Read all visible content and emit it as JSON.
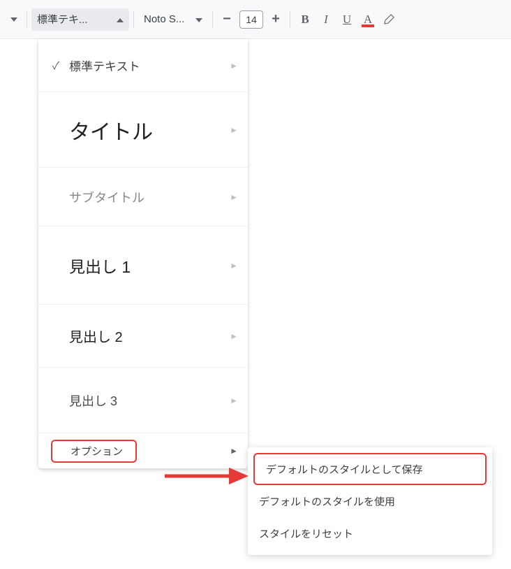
{
  "toolbar": {
    "style_dropdown_label": "標準テキ...",
    "font_dropdown_label": "Noto S...",
    "font_size": "14",
    "bold": "B",
    "italic": "I",
    "underline": "U",
    "textcolor": "A"
  },
  "styles_menu": {
    "items": [
      {
        "label": "標準テキスト",
        "checked": true
      },
      {
        "label": "タイトル",
        "checked": false
      },
      {
        "label": "サブタイトル",
        "checked": false
      },
      {
        "label": "見出し 1",
        "checked": false
      },
      {
        "label": "見出し 2",
        "checked": false
      },
      {
        "label": "見出し 3",
        "checked": false
      }
    ],
    "options_label": "オプション"
  },
  "submenu": {
    "items": [
      "デフォルトのスタイルとして保存",
      "デフォルトのスタイルを使用",
      "スタイルをリセット"
    ]
  },
  "annotation": {
    "arrow_color": "#e53935"
  }
}
